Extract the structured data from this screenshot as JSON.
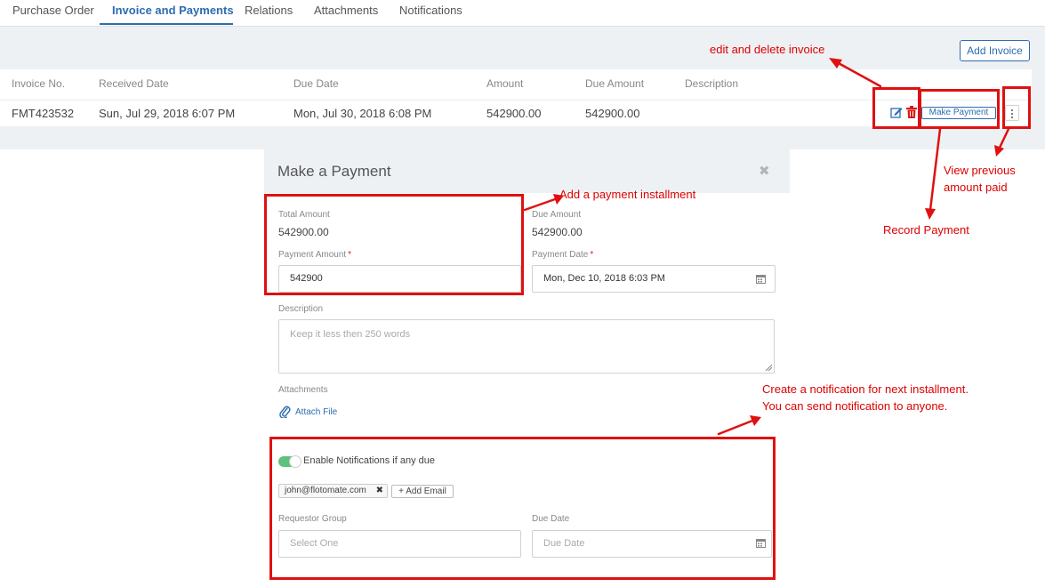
{
  "tabs": [
    "Purchase Order",
    "Invoice and Payments",
    "Relations",
    "Attachments",
    "Notifications"
  ],
  "active_tab": "Invoice and Payments",
  "add_invoice_label": "Add Invoice",
  "table": {
    "headers": [
      "Invoice No.",
      "Received Date",
      "Due Date",
      "Amount",
      "Due Amount",
      "Description"
    ],
    "rows": [
      {
        "invoice_no": "FMT423532",
        "received_date": "Sun, Jul 29, 2018 6:07 PM",
        "due_date": "Mon, Jul 30, 2018 6:08 PM",
        "amount": "542900.00",
        "due_amount": "542900.00",
        "description": "",
        "make_payment_label": "Make Payment"
      }
    ]
  },
  "modal": {
    "title": "Make a Payment",
    "close_icon": "times-icon",
    "total_amount_label": "Total Amount",
    "total_amount_value": "542900.00",
    "due_amount_label": "Due Amount",
    "due_amount_value": "542900.00",
    "payment_amount_label": "Payment Amount",
    "payment_amount_value": "542900",
    "payment_date_label": "Payment Date",
    "payment_date_value": "Mon, Dec 10, 2018 6:03 PM",
    "description_label": "Description",
    "description_placeholder": "Keep it less then 250 words",
    "attachments_label": "Attachments",
    "attach_file_label": "Attach File",
    "notification_toggle_label": "Enable Notifications if any due",
    "notification_enabled": true,
    "email_chips": [
      "john@flotomate.com"
    ],
    "add_email_label": "+ Add Email",
    "requestor_group_label": "Requestor Group",
    "requestor_group_placeholder": "Select One",
    "due_date_label": "Due Date",
    "due_date_placeholder": "Due Date"
  },
  "annotations": {
    "edit_delete": "edit and delete invoice",
    "view_previous_line1": "View previous",
    "view_previous_line2": "amount paid",
    "record_payment": "Record Payment",
    "add_installment": "Add a payment installment",
    "notification_line1": "Create a notification for next installment.",
    "notification_line2": "You can send notification to anyone."
  },
  "colors": {
    "accent": "#2c6cb0",
    "annotation": "#e01010",
    "toggle_on": "#5ec27a",
    "panel_bg": "#eef1f4"
  }
}
